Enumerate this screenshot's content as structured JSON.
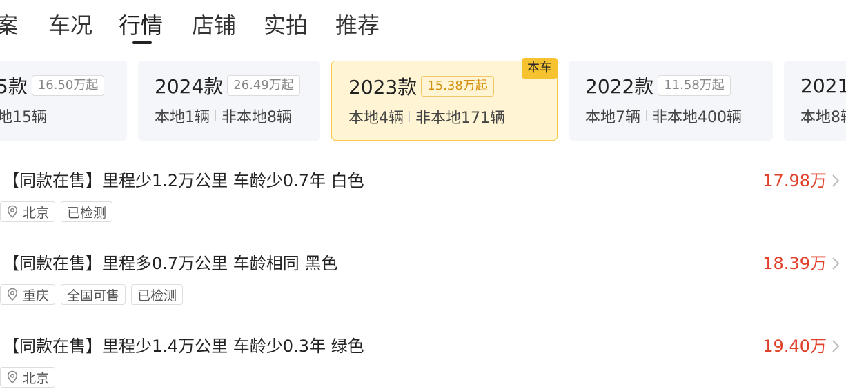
{
  "tabs": [
    {
      "label": "案"
    },
    {
      "label": "车况"
    },
    {
      "label": "行情"
    },
    {
      "label": "店铺"
    },
    {
      "label": "实拍"
    },
    {
      "label": "推荐"
    }
  ],
  "active_tab": "行情",
  "year_cards": [
    {
      "year": "5款",
      "price": "16.50万起",
      "local": "",
      "nonlocal": "地15辆",
      "selected": false
    },
    {
      "year": "2024款",
      "price": "26.49万起",
      "local": "本地1辆",
      "nonlocal": "非本地8辆",
      "selected": false
    },
    {
      "year": "2023款",
      "price": "15.38万起",
      "local": "本地4辆",
      "nonlocal": "非本地171辆",
      "selected": true,
      "badge": "本车"
    },
    {
      "year": "2022款",
      "price": "11.58万起",
      "local": "本地7辆",
      "nonlocal": "非本地400辆",
      "selected": false
    },
    {
      "year": "2021",
      "price": "",
      "local": "本地8辆",
      "nonlocal": "",
      "selected": false
    }
  ],
  "listings": [
    {
      "title": "【同款在售】里程少1.2万公里 车龄少0.7年 白色",
      "price": "17.98万",
      "location": "北京",
      "tags": [
        "已检测"
      ]
    },
    {
      "title": "【同款在售】里程多0.7万公里 车龄相同 黑色",
      "price": "18.39万",
      "location": "重庆",
      "tags": [
        "全国可售",
        "已检测"
      ]
    },
    {
      "title": "【同款在售】里程少1.4万公里 车龄少0.3年 绿色",
      "price": "19.40万",
      "location": "北京",
      "tags": []
    }
  ],
  "colors": {
    "price_red": "#e0402a",
    "selected_bg": "#fff5d4",
    "selected_border": "#f7c948",
    "badge_yellow": "#f7c230",
    "card_bg": "#f5f6fa"
  },
  "icons": {
    "location": "location-pin-icon",
    "more": "chevron-right-icon"
  }
}
